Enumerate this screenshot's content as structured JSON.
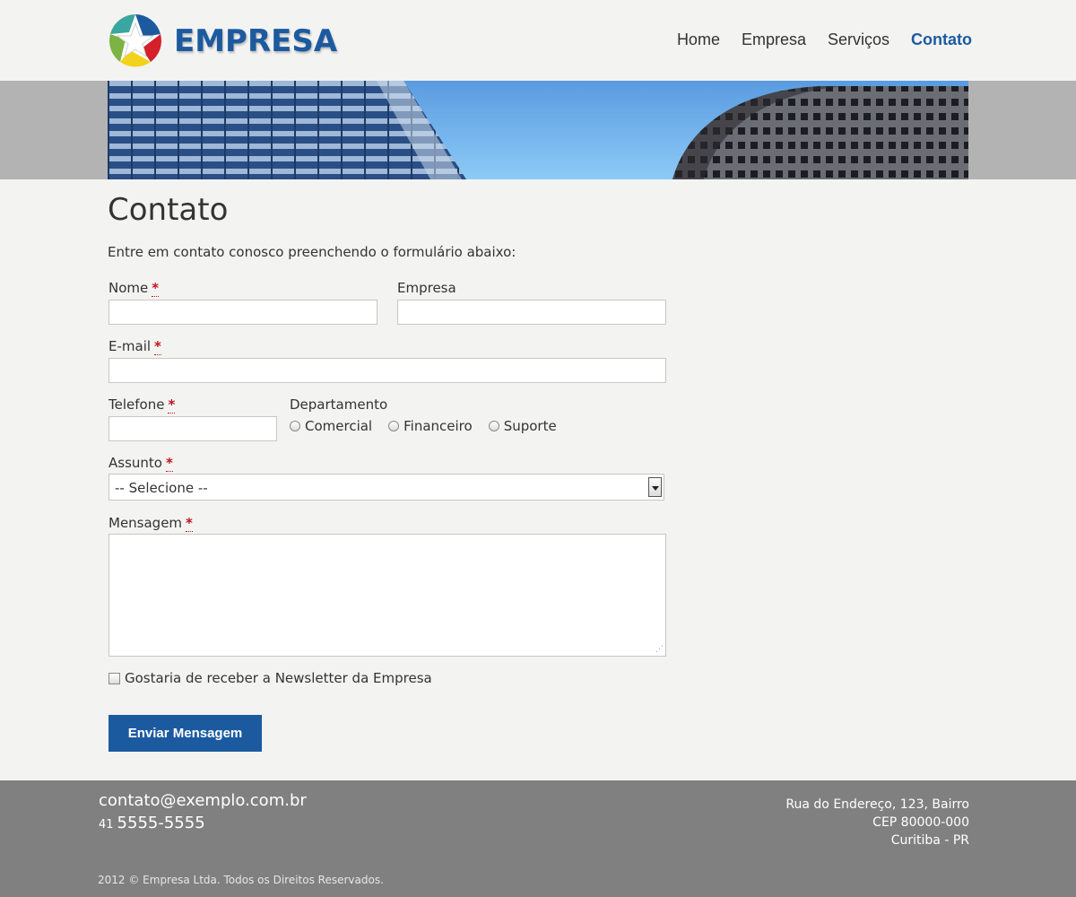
{
  "header": {
    "logo_text": "EMPRESA",
    "nav": [
      {
        "label": "Home",
        "active": false
      },
      {
        "label": "Empresa",
        "active": false
      },
      {
        "label": "Serviços",
        "active": false
      },
      {
        "label": "Contato",
        "active": true
      }
    ]
  },
  "main": {
    "title": "Contato",
    "intro": "Entre em contato conosco preenchendo o formulário abaixo:",
    "form": {
      "nome_label": "Nome",
      "empresa_label": "Empresa",
      "email_label": "E-mail",
      "telefone_label": "Telefone",
      "departamento_label": "Departamento",
      "departamento_options": [
        "Comercial",
        "Financeiro",
        "Suporte"
      ],
      "assunto_label": "Assunto",
      "assunto_selected": "-- Selecione --",
      "mensagem_label": "Mensagem",
      "required_mark": "*",
      "newsletter_label": "Gostaria de receber a Newsletter da Empresa",
      "submit_label": "Enviar Mensagem",
      "nome_value": "",
      "empresa_value": "",
      "email_value": "",
      "telefone_value": "",
      "mensagem_value": ""
    }
  },
  "footer": {
    "email": "contato@exemplo.com.br",
    "phone_ddd": "41",
    "phone_number": "5555-5555",
    "address_line1": "Rua do Endereço, 123, Bairro",
    "address_line2": "CEP 80000-000",
    "address_line3": "Curitiba - PR",
    "copyright": "2012 © Empresa Ltda. Todos os Direitos Reservados."
  },
  "colors": {
    "brand_blue": "#1c5aa0",
    "footer_gray": "#808080",
    "required_red": "#c0141e"
  }
}
